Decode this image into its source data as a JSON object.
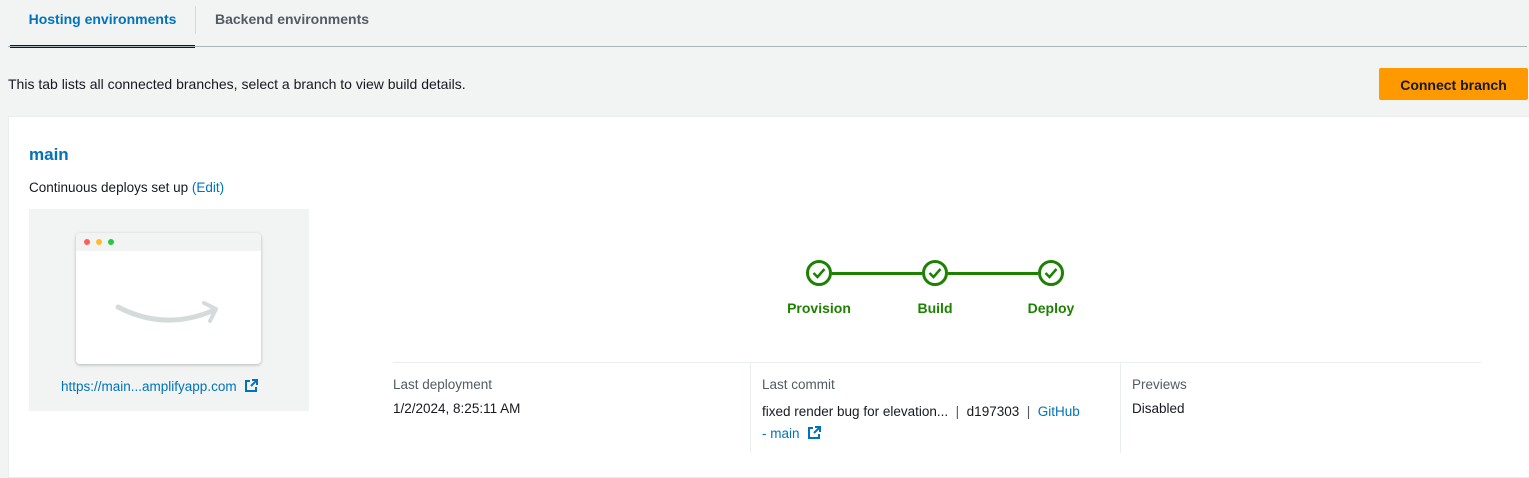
{
  "tabs": [
    {
      "label": "Hosting environments",
      "active": true
    },
    {
      "label": "Backend environments",
      "active": false
    }
  ],
  "description": "This tab lists all connected branches, select a branch to view build details.",
  "connect_button_label": "Connect branch",
  "branch": {
    "name": "main",
    "cd_text": "Continuous deploys set up",
    "edit_label": "(Edit)",
    "site_url": "https://main...amplifyapp.com"
  },
  "pipeline": {
    "steps": [
      {
        "label": "Provision",
        "status": "success"
      },
      {
        "label": "Build",
        "status": "success"
      },
      {
        "label": "Deploy",
        "status": "success"
      }
    ]
  },
  "details": {
    "last_deployment_label": "Last deployment",
    "last_deployment_value": "1/2/2024, 8:25:11 AM",
    "last_commit_label": "Last commit",
    "commit_message": "fixed render bug for elevation...",
    "separator": "|",
    "commit_hash": "d197303",
    "commit_source_github": "GitHub",
    "commit_source_branch": "- main",
    "previews_label": "Previews",
    "previews_value": "Disabled"
  },
  "colors": {
    "accent": "#0073bb",
    "primary_button": "#ff9900",
    "success": "#1d8102"
  }
}
